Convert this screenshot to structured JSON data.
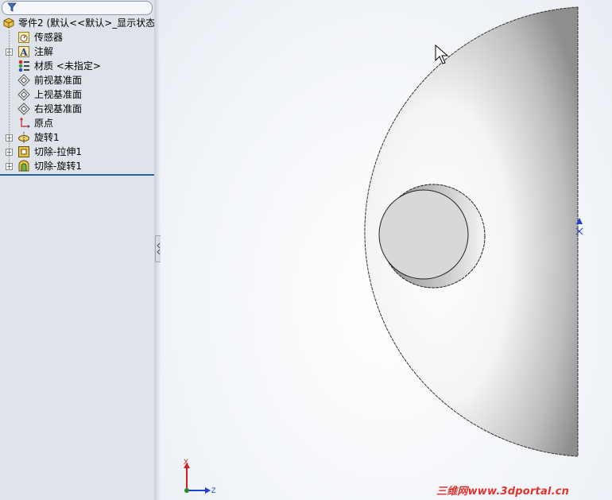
{
  "filter": {
    "icon": "filter-icon"
  },
  "tree": {
    "root": {
      "label": "零件2  (默认<<默认>_显示状态",
      "icon": "part-icon"
    },
    "items": [
      {
        "label": "传感器",
        "icon": "sensor-icon",
        "expandable": false
      },
      {
        "label": "注解",
        "icon": "annotation-icon",
        "expandable": true
      },
      {
        "label": "材质 <未指定>",
        "icon": "material-icon",
        "expandable": false
      },
      {
        "label": "前视基准面",
        "icon": "plane-icon",
        "expandable": false
      },
      {
        "label": "上视基准面",
        "icon": "plane-icon",
        "expandable": false
      },
      {
        "label": "右视基准面",
        "icon": "plane-icon",
        "expandable": false
      },
      {
        "label": "原点",
        "icon": "origin-icon",
        "expandable": false
      },
      {
        "label": "旋转1",
        "icon": "revolve-icon",
        "expandable": true
      },
      {
        "label": "切除-拉伸1",
        "icon": "cut-extrude-icon",
        "expandable": true
      },
      {
        "label": "切除-旋转1",
        "icon": "cut-revolve-icon",
        "expandable": true
      }
    ]
  },
  "triad": {
    "x_label": "X",
    "z_label": "Z"
  },
  "watermark": "三维网www.3dportal.cn",
  "colors": {
    "tree_selection_line": "#2a5fa5",
    "axis_x": "#d22020",
    "axis_z": "#2040d0",
    "watermark": "#e0332e"
  }
}
